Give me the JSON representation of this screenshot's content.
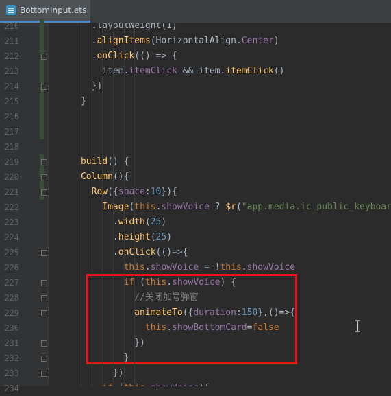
{
  "tab": {
    "filename": "BottomInput.ets",
    "icon": "ets-file-icon"
  },
  "colors": {
    "background": "#2b2b2b",
    "highlight_box": "#e81416",
    "keyword": "#cc7832",
    "function": "#ffc66d",
    "string": "#6a8759",
    "number": "#6897bb",
    "field": "#9876aa",
    "comment": "#808080"
  },
  "code": {
    "lines": [
      {
        "n": "210",
        "tokens": [
          {
            "t": "        .layoutWeight(1)",
            "c": "plain"
          }
        ]
      },
      {
        "n": "211",
        "tokens": [
          {
            "t": "        .",
            "c": "plain"
          },
          {
            "t": "alignItems",
            "c": "fn"
          },
          {
            "t": "(HorizontalAlign.",
            "c": "plain"
          },
          {
            "t": "Center",
            "c": "field"
          },
          {
            "t": ")",
            "c": "plain"
          }
        ]
      },
      {
        "n": "212",
        "tokens": [
          {
            "t": "        .",
            "c": "plain"
          },
          {
            "t": "onClick",
            "c": "fn"
          },
          {
            "t": "(() => {",
            "c": "plain"
          }
        ]
      },
      {
        "n": "213",
        "tokens": [
          {
            "t": "          item.",
            "c": "plain"
          },
          {
            "t": "itemClick",
            "c": "field"
          },
          {
            "t": " && item.",
            "c": "plain"
          },
          {
            "t": "itemClick",
            "c": "fn"
          },
          {
            "t": "()",
            "c": "plain"
          }
        ]
      },
      {
        "n": "214",
        "tokens": [
          {
            "t": "        })",
            "c": "plain"
          }
        ]
      },
      {
        "n": "215",
        "tokens": [
          {
            "t": "      }",
            "c": "plain"
          }
        ]
      },
      {
        "n": "216",
        "tokens": []
      },
      {
        "n": "217",
        "tokens": []
      },
      {
        "n": "218",
        "tokens": []
      },
      {
        "n": "219",
        "tokens": [
          {
            "t": "      ",
            "c": "plain"
          },
          {
            "t": "build",
            "c": "fn"
          },
          {
            "t": "() {",
            "c": "plain"
          }
        ]
      },
      {
        "n": "220",
        "tokens": [
          {
            "t": "      ",
            "c": "plain"
          },
          {
            "t": "Column",
            "c": "fn"
          },
          {
            "t": "(){",
            "c": "plain"
          }
        ]
      },
      {
        "n": "221",
        "tokens": [
          {
            "t": "        ",
            "c": "plain"
          },
          {
            "t": "Row",
            "c": "fn"
          },
          {
            "t": "({",
            "c": "plain"
          },
          {
            "t": "space",
            "c": "field"
          },
          {
            "t": ":",
            "c": "plain"
          },
          {
            "t": "10",
            "c": "num"
          },
          {
            "t": "}){",
            "c": "plain"
          }
        ]
      },
      {
        "n": "222",
        "tokens": [
          {
            "t": "          ",
            "c": "plain"
          },
          {
            "t": "Image",
            "c": "fn"
          },
          {
            "t": "(",
            "c": "plain"
          },
          {
            "t": "this",
            "c": "kw"
          },
          {
            "t": ".",
            "c": "plain"
          },
          {
            "t": "showVoice",
            "c": "field"
          },
          {
            "t": " ? ",
            "c": "plain"
          },
          {
            "t": "$r",
            "c": "fn"
          },
          {
            "t": "(",
            "c": "plain"
          },
          {
            "t": "\"app.media.ic_public_keyboard\"",
            "c": "str"
          },
          {
            "t": ")",
            "c": "plain"
          }
        ]
      },
      {
        "n": "223",
        "tokens": [
          {
            "t": "            .",
            "c": "plain"
          },
          {
            "t": "width",
            "c": "fn"
          },
          {
            "t": "(",
            "c": "plain"
          },
          {
            "t": "25",
            "c": "num"
          },
          {
            "t": ")",
            "c": "plain"
          }
        ]
      },
      {
        "n": "224",
        "tokens": [
          {
            "t": "            .",
            "c": "plain"
          },
          {
            "t": "height",
            "c": "fn"
          },
          {
            "t": "(",
            "c": "plain"
          },
          {
            "t": "25",
            "c": "num"
          },
          {
            "t": ")",
            "c": "plain"
          }
        ]
      },
      {
        "n": "225",
        "tokens": [
          {
            "t": "            .",
            "c": "plain"
          },
          {
            "t": "onClick",
            "c": "fn"
          },
          {
            "t": "(()=>{",
            "c": "plain"
          }
        ]
      },
      {
        "n": "226",
        "tokens": [
          {
            "t": "              ",
            "c": "plain"
          },
          {
            "t": "this",
            "c": "kw"
          },
          {
            "t": ".",
            "c": "plain"
          },
          {
            "t": "showVoice",
            "c": "field"
          },
          {
            "t": " = !",
            "c": "plain"
          },
          {
            "t": "this",
            "c": "kw"
          },
          {
            "t": ".",
            "c": "plain"
          },
          {
            "t": "showVoice",
            "c": "field"
          }
        ]
      },
      {
        "n": "227",
        "tokens": [
          {
            "t": "              ",
            "c": "plain"
          },
          {
            "t": "if",
            "c": "kw"
          },
          {
            "t": " (",
            "c": "plain"
          },
          {
            "t": "this",
            "c": "kw"
          },
          {
            "t": ".",
            "c": "plain"
          },
          {
            "t": "showVoice",
            "c": "field"
          },
          {
            "t": ") {",
            "c": "plain"
          }
        ]
      },
      {
        "n": "228",
        "tokens": [
          {
            "t": "                ",
            "c": "plain"
          },
          {
            "t": "//关闭加号弹窗",
            "c": "cm"
          }
        ]
      },
      {
        "n": "229",
        "tokens": [
          {
            "t": "                ",
            "c": "plain"
          },
          {
            "t": "animateTo",
            "c": "fn"
          },
          {
            "t": "({",
            "c": "plain"
          },
          {
            "t": "duration",
            "c": "field"
          },
          {
            "t": ":",
            "c": "plain"
          },
          {
            "t": "150",
            "c": "num"
          },
          {
            "t": "},()=>{",
            "c": "plain"
          }
        ]
      },
      {
        "n": "230",
        "tokens": [
          {
            "t": "                  ",
            "c": "plain"
          },
          {
            "t": "this",
            "c": "kw"
          },
          {
            "t": ".",
            "c": "plain"
          },
          {
            "t": "showBottomCard",
            "c": "field"
          },
          {
            "t": "=",
            "c": "plain"
          },
          {
            "t": "false",
            "c": "kw"
          }
        ]
      },
      {
        "n": "231",
        "tokens": [
          {
            "t": "                })",
            "c": "plain"
          }
        ]
      },
      {
        "n": "232",
        "tokens": [
          {
            "t": "              }",
            "c": "plain"
          }
        ]
      },
      {
        "n": "233",
        "tokens": [
          {
            "t": "            })",
            "c": "plain"
          }
        ]
      },
      {
        "n": "234",
        "tokens": [
          {
            "t": "          ",
            "c": "plain"
          },
          {
            "t": "if",
            "c": "kw"
          },
          {
            "t": " (",
            "c": "plain"
          },
          {
            "t": "this",
            "c": "kw"
          },
          {
            "t": ".",
            "c": "plain"
          },
          {
            "t": "showVoice",
            "c": "field"
          },
          {
            "t": "){",
            "c": "plain"
          }
        ]
      }
    ]
  }
}
